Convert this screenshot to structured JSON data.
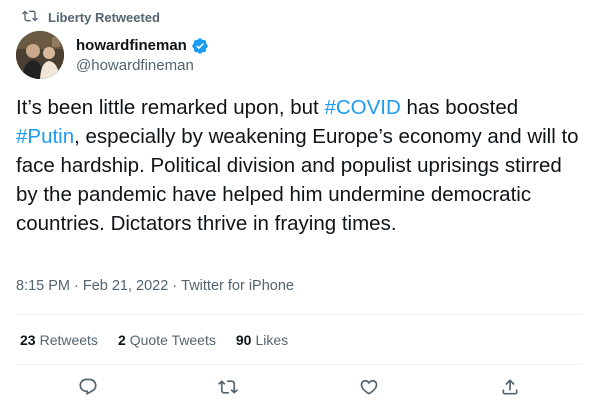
{
  "retweet_header": {
    "text": "Liberty Retweeted",
    "icon": "retweet-icon"
  },
  "author": {
    "display_name": "howardfineman",
    "handle": "@howardfineman",
    "verified_icon": "verified-badge-icon"
  },
  "tweet": {
    "segments": [
      {
        "text": "It’s been little remarked upon, but ",
        "type": "text"
      },
      {
        "text": "#COVID",
        "type": "hashtag"
      },
      {
        "text": " has boosted ",
        "type": "text"
      },
      {
        "text": "#Putin",
        "type": "hashtag"
      },
      {
        "text": ", especially by weakening Europe’s economy and will to face hardship. Political division and populist uprisings stirred by the pandemic have helped him undermine democratic countries. Dictators thrive in fraying times.",
        "type": "text"
      }
    ]
  },
  "meta": {
    "time": "8:15 PM",
    "separator1": "·",
    "date": "Feb 21, 2022",
    "separator2": "·",
    "source": "Twitter for iPhone"
  },
  "stats": {
    "retweets_count": "23",
    "retweets_label": "Retweets",
    "quotes_count": "2",
    "quotes_label": "Quote Tweets",
    "likes_count": "90",
    "likes_label": "Likes"
  },
  "actions": {
    "reply_icon": "reply-icon",
    "retweet_icon": "retweet-icon",
    "like_icon": "heart-icon",
    "share_icon": "share-icon"
  },
  "colors": {
    "link": "#1d9bf0",
    "secondary_text": "#536471",
    "primary_text": "#0f1419",
    "divider": "#eff3f4"
  }
}
